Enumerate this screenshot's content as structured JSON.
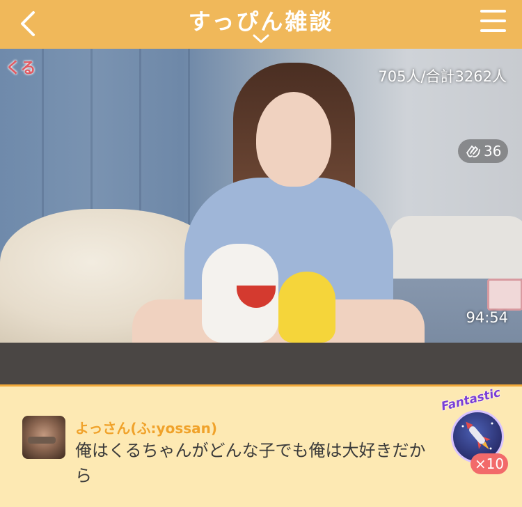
{
  "header": {
    "title": "すっぴん雑談",
    "back_icon": "chevron-left-icon",
    "menu_icon": "hamburger-icon",
    "expand_icon": "chevron-down-icon",
    "background_color": "#f0b85a"
  },
  "stream": {
    "host_tag": "くる",
    "viewers": "705人/合計3262人",
    "clap_count": "36",
    "elapsed": "94:54"
  },
  "comment": {
    "username": "よっさん(ふ:yossan)",
    "message": "俺はくるちゃんがどんな子でも俺は大好きだから",
    "badge_label": "Fantastic",
    "badge_multiplier": "×10",
    "username_color": "#f0a22a",
    "background_color": "#fde9b3"
  }
}
